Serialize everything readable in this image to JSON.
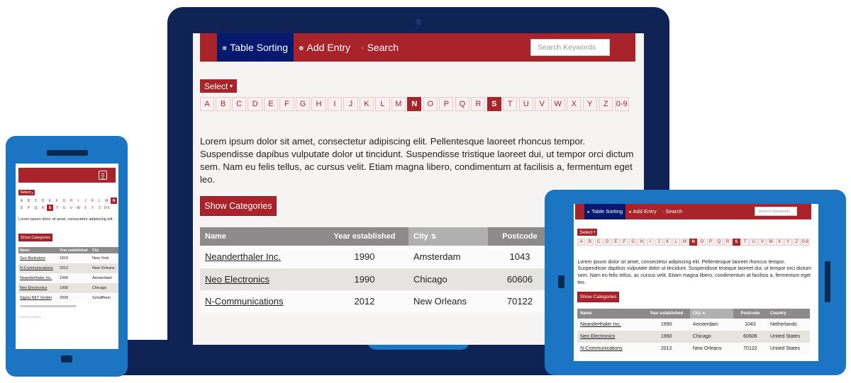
{
  "nav": {
    "items": [
      {
        "label": "Table Sorting",
        "icon": "list-icon"
      },
      {
        "label": "Add Entry",
        "icon": "plus-circle-icon"
      },
      {
        "label": "Search",
        "icon": "search-icon"
      }
    ],
    "search_placeholder": "Search Keywords"
  },
  "select_label": "Select",
  "alphabet": [
    "A",
    "B",
    "C",
    "D",
    "E",
    "F",
    "G",
    "H",
    "I",
    "J",
    "K",
    "L",
    "M",
    "N",
    "O",
    "P",
    "Q",
    "R",
    "S",
    "T",
    "U",
    "V",
    "W",
    "X",
    "Y",
    "Z",
    "0-9"
  ],
  "alphabet_active": [
    "N",
    "S"
  ],
  "lorem": "Lorem ipsum dolor sit amet, consectetur adipiscing elit. Pellentesque laoreet rhoncus tempor. Suspendisse dapibus vulputate dolor ut tincidunt. Suspendisse tristique laoreet dui, ut tempor orci dictum sem. Nam eu felis tellus, ac cursus velit. Etiam magna libero, condimentum at facilisis a, fermentum eget leo.",
  "lorem_short": "Lorem ipsum dolor sit amet, consectetur adipiscing elit.",
  "show_categories": "Show Categories",
  "table": {
    "headers": [
      "Name",
      "Year established",
      "City",
      "Postcode",
      "Country"
    ],
    "rows": [
      [
        "Neanderthaler Inc.",
        "1990",
        "Amsterdam",
        "1043",
        "Netherlands"
      ],
      [
        "Neo Electronics",
        "1990",
        "Chicago",
        "60606",
        "United States"
      ],
      [
        "N-Communications",
        "2012",
        "New Orleans",
        "70122",
        "United States"
      ]
    ]
  },
  "phone_table": {
    "headers": [
      "Name",
      "Year established",
      "City"
    ],
    "rows": [
      [
        "Sun Bookstore",
        "1810",
        "New York"
      ],
      [
        "N-Communications",
        "2012",
        "New Orleans"
      ],
      [
        "Neanderthaler Inc.",
        "1990",
        "Amsterdam"
      ],
      [
        "Neo Electronics",
        "1990",
        "Chicago"
      ],
      [
        "Sigsiu.NET GmbH",
        "2009",
        "Schaffhein"
      ]
    ]
  },
  "phone_footer": "Powered by SobiPro",
  "colors": {
    "brand": "#a9232b",
    "nav_active": "#07196e",
    "device_blue": "#1b75c2",
    "laptop": "#0f2454"
  }
}
